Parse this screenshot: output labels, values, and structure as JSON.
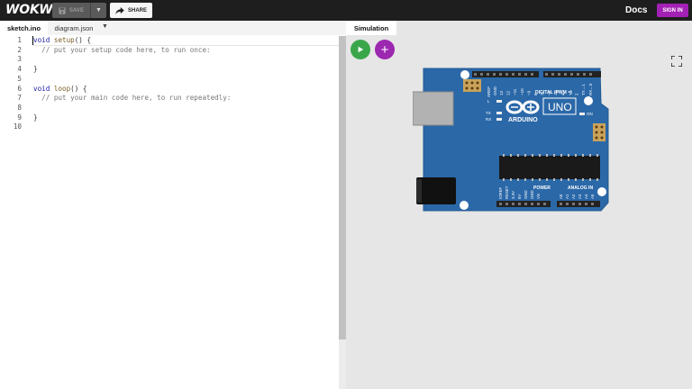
{
  "header": {
    "logo": "WOKWI",
    "save_label": "SAVE",
    "share_label": "SHARE",
    "docs_label": "Docs",
    "signin_label": "SIGN IN"
  },
  "editor": {
    "tabs": [
      {
        "label": "sketch.ino"
      },
      {
        "label": "diagram.json"
      }
    ],
    "line_numbers": [
      "1",
      "2",
      "3",
      "4",
      "5",
      "6",
      "7",
      "8",
      "9",
      "10"
    ],
    "lines": [
      {
        "kw": "void",
        "fn": "setup",
        "rest": "() {"
      },
      {
        "cm": "  // put your setup code here, to run once:"
      },
      {
        "txt": ""
      },
      {
        "txt": "}"
      },
      {
        "txt": ""
      },
      {
        "kw": "void",
        "fn": "loop",
        "rest": "() {"
      },
      {
        "cm": "  // put your main code here, to run repeatedly:"
      },
      {
        "txt": ""
      },
      {
        "txt": "}"
      },
      {
        "txt": ""
      }
    ]
  },
  "simulation": {
    "tab_label": "Simulation",
    "board": {
      "name": "UNO",
      "brand": "ARDUINO",
      "digital_label": "DIGITAL (PWM ~)",
      "power_label": "POWER",
      "analog_label": "ANALOG IN",
      "on_label": "ON",
      "tx_label": "TX",
      "rx_label": "RX",
      "l_label": "L",
      "aref_label": "AREF",
      "gnd_label": "GND",
      "top_pins": [
        "13",
        "12",
        "~11",
        "~10",
        "~9",
        "8",
        "7",
        "~6",
        "~5",
        "4",
        "~3",
        "2",
        "TX→1",
        "RX←0"
      ],
      "power_pins": [
        "IOREF",
        "RESET",
        "3.3V",
        "5V",
        "GND",
        "GND",
        "Vin"
      ],
      "analog_pins": [
        "A0",
        "A1",
        "A2",
        "A3",
        "A4",
        "A5"
      ]
    }
  },
  "colors": {
    "topbar": "#1e1e1e",
    "accent_purple": "#a320b5",
    "play_green": "#3aa64a",
    "board_blue": "#2b68a8"
  }
}
